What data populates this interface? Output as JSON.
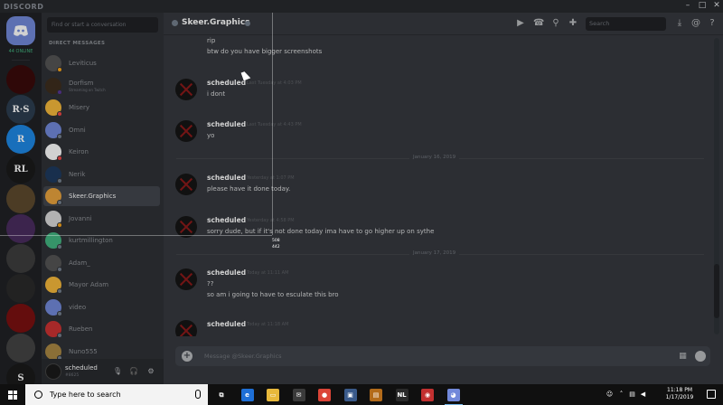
{
  "window": {
    "brand": "DISCORD",
    "controls": [
      "–",
      "□",
      "✕"
    ]
  },
  "servers": {
    "online_label": "44 ONLINE",
    "items": [
      {
        "name": "server-1",
        "label": "",
        "color": "#3a0a0a"
      },
      {
        "name": "server-2",
        "label": "R·S",
        "color": "#2c3e50"
      },
      {
        "name": "server-3",
        "label": "R",
        "color": "#1e88e5"
      },
      {
        "name": "server-4",
        "label": "RL",
        "color": "#1a1a1a"
      },
      {
        "name": "server-5",
        "label": "",
        "color": "#5d4a2e"
      },
      {
        "name": "server-6",
        "label": "",
        "color": "#4a2c5e"
      },
      {
        "name": "server-7",
        "label": "",
        "color": "#3d3d3d"
      },
      {
        "name": "server-8",
        "label": "",
        "color": "#2a2a2a"
      },
      {
        "name": "server-9",
        "label": "",
        "color": "#7a1010"
      },
      {
        "name": "server-10",
        "label": "",
        "color": "#444444"
      },
      {
        "name": "server-11",
        "label": "S",
        "color": "#1a1a1a"
      },
      {
        "name": "server-12",
        "label": "",
        "color": "#6b2020"
      }
    ]
  },
  "dm": {
    "search_placeholder": "Find or start a conversation",
    "header": "DIRECT MESSAGES",
    "items": [
      {
        "name": "Leviticus",
        "color": "#555555",
        "status": "#faa61a"
      },
      {
        "name": "Dorfism",
        "sub": "Streaming on Twitch",
        "color": "#3d2e1e",
        "status": "#593695"
      },
      {
        "name": "Misery",
        "color": "#f6b93b",
        "status": "#f04747"
      },
      {
        "name": "Omni",
        "color": "#7289da",
        "status": "#747f8d"
      },
      {
        "name": "Keiron",
        "color": "#ffffff",
        "status": "#f04747"
      },
      {
        "name": "Nerik",
        "color": "#1e3a5f",
        "status": "#747f8d"
      },
      {
        "name": "Skeer.Graphics",
        "color": "#e8a33d",
        "status": "#747f8d"
      },
      {
        "name": "Jovanni",
        "color": "#d9d9d9",
        "status": "#faa61a"
      },
      {
        "name": "kurtmillington",
        "color": "#43b581",
        "status": "#747f8d"
      },
      {
        "name": "Adam_",
        "color": "#555555",
        "status": "#747f8d"
      },
      {
        "name": "Mayor Adam",
        "color": "#f6b93b",
        "status": "#747f8d"
      },
      {
        "name": "video",
        "color": "#7289da",
        "status": "#747f8d"
      },
      {
        "name": "Rueben",
        "color": "#cc3333",
        "status": "#747f8d"
      },
      {
        "name": "Nuno555",
        "color": "#aa8844",
        "status": "#747f8d"
      }
    ],
    "user": {
      "name": "scheduled",
      "tag": "#8625"
    }
  },
  "channel": {
    "name": "Skeer.Graphics",
    "search_placeholder": "Search"
  },
  "messages": {
    "top_lines": [
      "rip",
      "btw do you have bigger screenshots"
    ],
    "groups": [
      {
        "author": "scheduled",
        "time": "Last Tuesday at 4:03 PM",
        "lines": [
          "i dont"
        ]
      },
      {
        "author": "scheduled",
        "time": "Last Tuesday at 4:43 PM",
        "lines": [
          "yo"
        ]
      },
      {
        "author": "scheduled",
        "time": "Yesterday at 1:07 PM",
        "lines": [
          "please have it done today."
        ]
      },
      {
        "author": "scheduled",
        "time": "Yesterday at 4:58 PM",
        "lines": [
          "sorry dude, but if it's not done today ima have to go higher up on sythe"
        ]
      },
      {
        "author": "scheduled",
        "time": "Today at 11:11 AM",
        "lines": [
          "??",
          "so am i going to have to esculate this bro"
        ]
      },
      {
        "author": "scheduled",
        "time": "Today at 11:18 AM",
        "lines": []
      }
    ],
    "dividers": [
      "January 16, 2019",
      "January 17, 2019"
    ]
  },
  "composer": {
    "placeholder": "Message @Skeer.Graphics"
  },
  "capture": {
    "coord_x": "508",
    "coord_y": "442"
  },
  "taskbar": {
    "search_placeholder": "Type here to search",
    "time": "11:18 PM",
    "date": "1/17/2019",
    "apps": [
      {
        "name": "task-view-icon",
        "glyph": "⧉",
        "color": "#101010"
      },
      {
        "name": "edge-icon",
        "glyph": "e",
        "color": "#1e6fd6"
      },
      {
        "name": "file-explorer-icon",
        "glyph": "▭",
        "color": "#e8b93b"
      },
      {
        "name": "mail-icon",
        "glyph": "✉",
        "color": "#3a3a3a"
      },
      {
        "name": "chrome-icon",
        "glyph": "●",
        "color": "#db4437"
      },
      {
        "name": "app-icon-1",
        "glyph": "▣",
        "color": "#3a5a8a"
      },
      {
        "name": "app-icon-2",
        "glyph": "▤",
        "color": "#b36b1a"
      },
      {
        "name": "app-icon-3",
        "glyph": "NL",
        "color": "#2a2a2a"
      },
      {
        "name": "app-icon-4",
        "glyph": "◉",
        "color": "#c23030"
      },
      {
        "name": "discord-taskbar-icon",
        "glyph": "◕",
        "color": "#7289da"
      }
    ]
  }
}
